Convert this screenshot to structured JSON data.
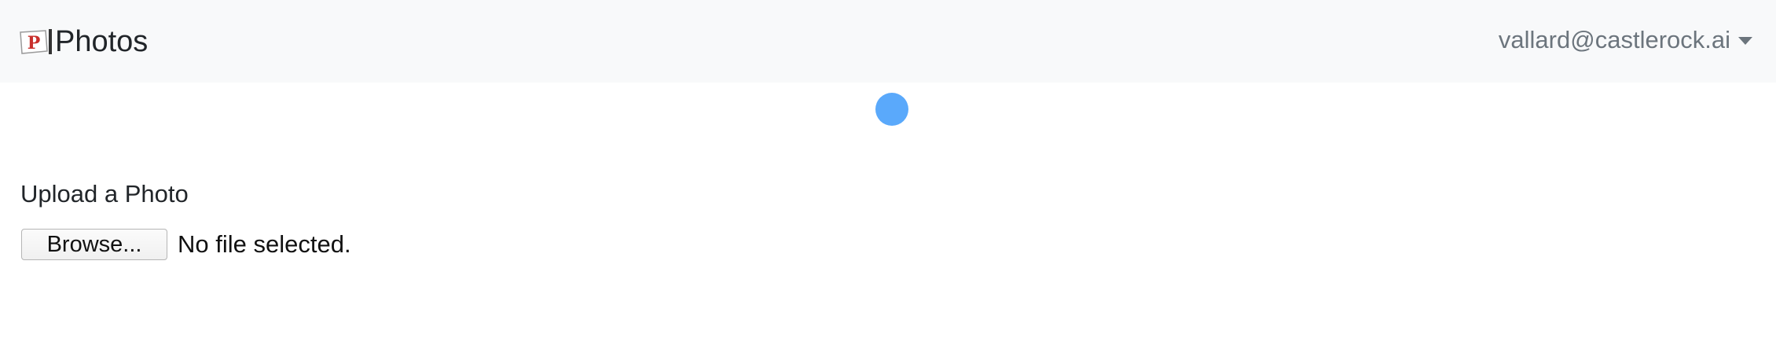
{
  "navbar": {
    "brand_logo_letter": "P",
    "brand_title": "Photos",
    "user_email": "vallard@castlerock.ai",
    "logo_icon": "photos-logo-icon",
    "dropdown_icon": "caret-down-icon"
  },
  "loading": {
    "icon": "loading-spinner-icon",
    "color": "#5aa9fb"
  },
  "upload": {
    "label": "Upload a Photo",
    "browse_button_label": "Browse...",
    "file_status": "No file selected."
  },
  "colors": {
    "navbar_bg": "#f8f9fa",
    "logo_red": "#c9302c",
    "muted_text": "#6c757d"
  }
}
